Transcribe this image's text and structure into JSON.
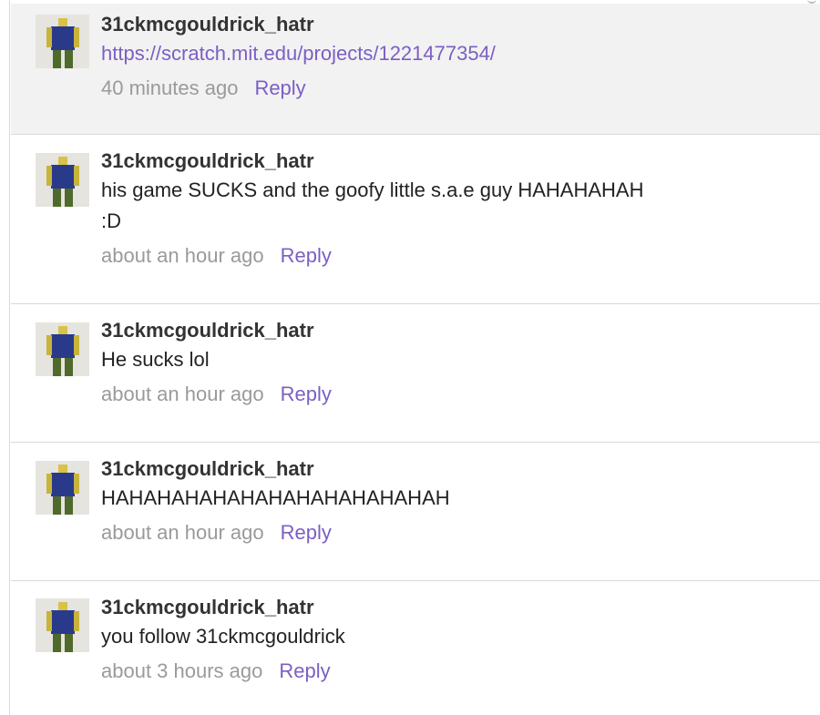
{
  "comments": [
    {
      "username": "31ckmcgouldrick_hatr",
      "text": "https://scratch.mit.edu/projects/1221477354/",
      "time": "40 minutes ago",
      "reply_label": "Reply"
    },
    {
      "username": "31ckmcgouldrick_hatr",
      "text": "his game SUCKS and the goofy little s.a.e guy HAHAHAHAH\n:D",
      "time": "about an hour ago",
      "reply_label": "Reply"
    },
    {
      "username": "31ckmcgouldrick_hatr",
      "text": "He sucks lol",
      "time": "about an hour ago",
      "reply_label": "Reply"
    },
    {
      "username": "31ckmcgouldrick_hatr",
      "text": "HAHAHAHAHAHAHAHAHAHAHAHAH",
      "time": "about an hour ago",
      "reply_label": "Reply"
    },
    {
      "username": "31ckmcgouldrick_hatr",
      "text": "you follow 31ckmcgouldrick",
      "time": "about 3 hours ago",
      "reply_label": "Reply"
    }
  ],
  "colors": {
    "link": "#7b5fc3",
    "timestamp": "#9a9a9a",
    "highlight_bg": "#f2f2f2",
    "divider": "#d9d9d9"
  },
  "icons": {
    "avatar": "blocky-avatar-icon"
  }
}
